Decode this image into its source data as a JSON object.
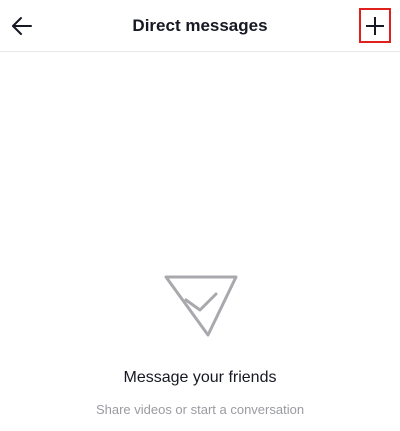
{
  "header": {
    "title": "Direct messages",
    "back_icon": "arrow-left-icon",
    "new_message_icon": "plus-icon",
    "highlight_color": "#e0201c"
  },
  "empty_state": {
    "icon": "paper-plane-icon",
    "title": "Message your friends",
    "subtitle": "Share videos or start a conversation"
  }
}
